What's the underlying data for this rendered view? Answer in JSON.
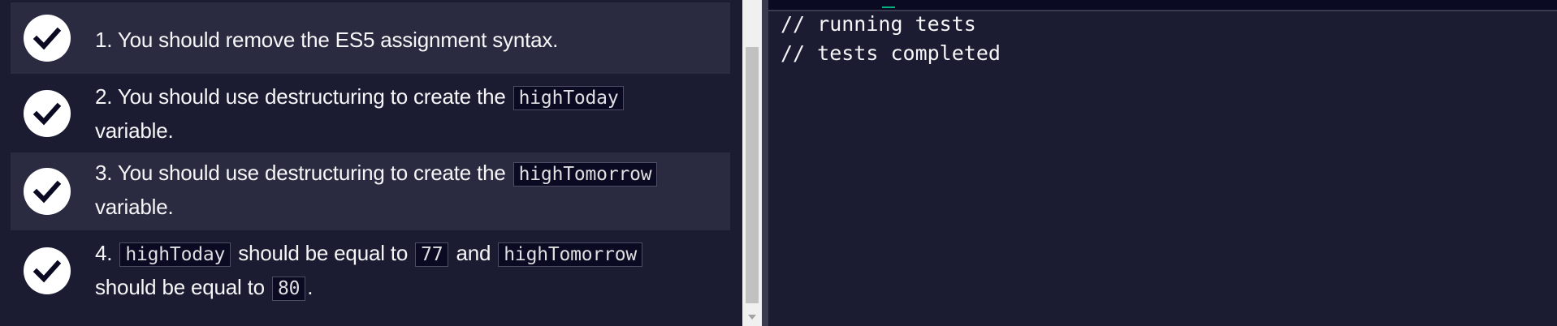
{
  "tests": [
    {
      "number": "1.",
      "text": "You should remove the ES5 assignment syntax.",
      "status": "passed"
    },
    {
      "number": "2.",
      "before": "You should use destructuring to create the",
      "code": "highToday",
      "after": "variable.",
      "status": "passed"
    },
    {
      "number": "3.",
      "before": "You should use destructuring to create the",
      "code": "highTomorrow",
      "after": "variable.",
      "status": "passed"
    },
    {
      "number": "4.",
      "code1": "highToday",
      "mid1": "should be equal to",
      "code2": "77",
      "mid2": "and",
      "code3": "highTomorrow",
      "mid3": "should be equal to",
      "code4": "80",
      "end": ".",
      "status": "passed"
    }
  ],
  "console": {
    "lines": [
      "// running tests",
      "// tests completed"
    ]
  },
  "colors": {
    "background": "#1b1b32",
    "row_alt": "#2a2a40",
    "text": "#f5f6f7",
    "code_bg": "#0a0a23",
    "check_bg": "#ffffff"
  },
  "icons": {
    "check": "checkmark-circle-icon"
  }
}
